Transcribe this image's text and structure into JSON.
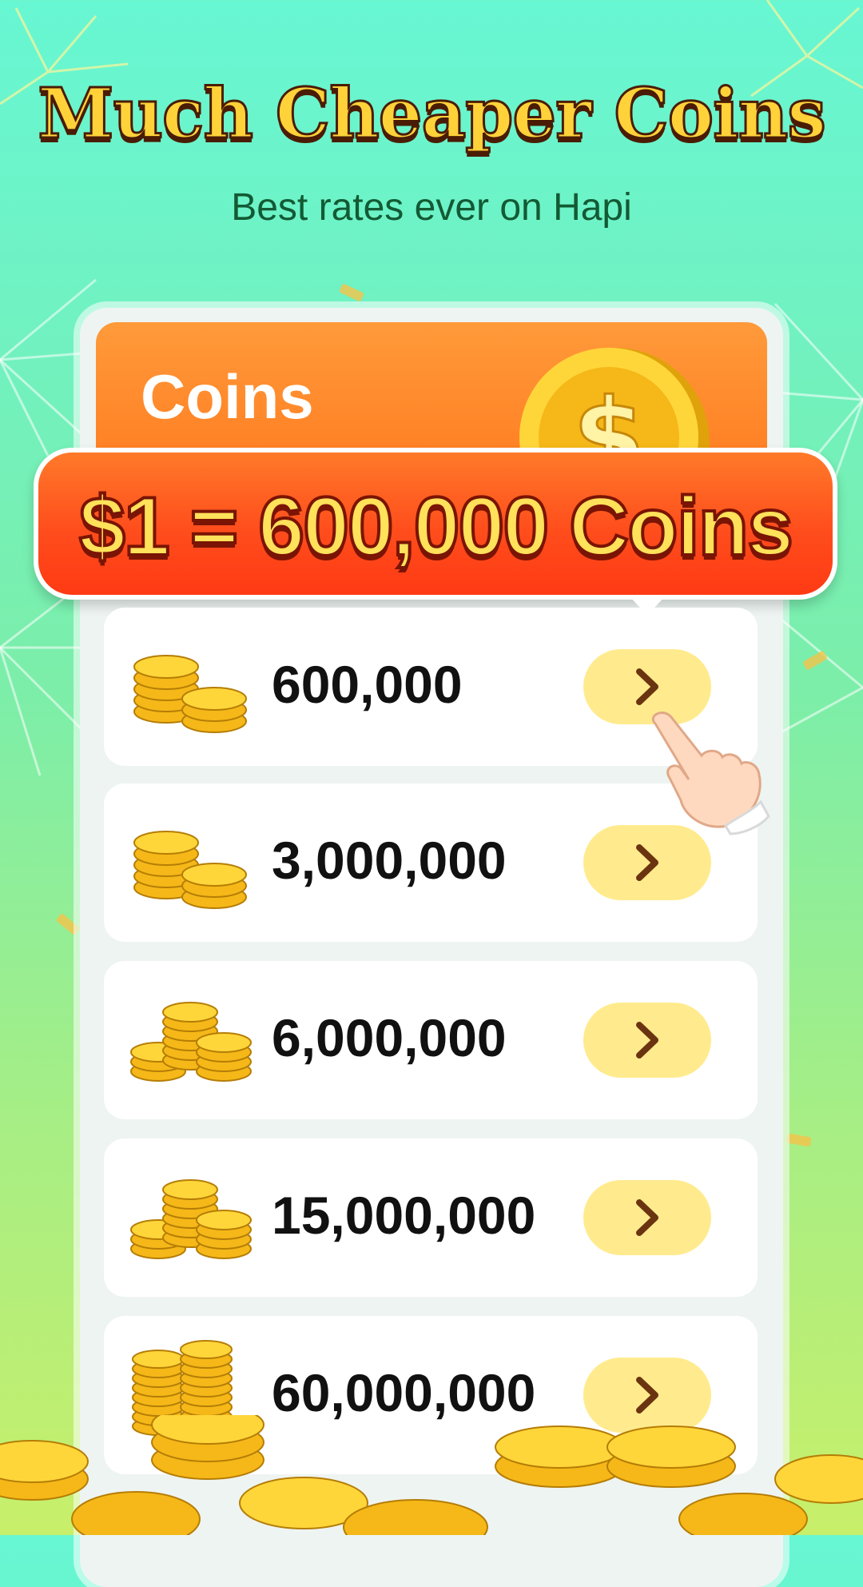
{
  "header": {
    "title": "Much Cheaper Coins",
    "subtitle": "Best rates ever on Hapi"
  },
  "panel": {
    "label": "Coins",
    "rate_banner": "$1 = 600,000 Coins"
  },
  "packages": [
    {
      "amount": "600,000",
      "icon": "coin-stack-small-icon"
    },
    {
      "amount": "3,000,000",
      "icon": "coin-stack-small-icon"
    },
    {
      "amount": "6,000,000",
      "icon": "coin-pile-medium-icon"
    },
    {
      "amount": "15,000,000",
      "icon": "coin-pile-medium-icon"
    },
    {
      "amount": "60,000,000",
      "icon": "coin-pile-large-icon"
    }
  ],
  "colors": {
    "accent_orange": "#ff7a1f",
    "banner_red": "#ff3a14",
    "button_yellow": "#ffeb8e",
    "chevron_brown": "#6b3410",
    "title_gold": "#ffd23a"
  }
}
